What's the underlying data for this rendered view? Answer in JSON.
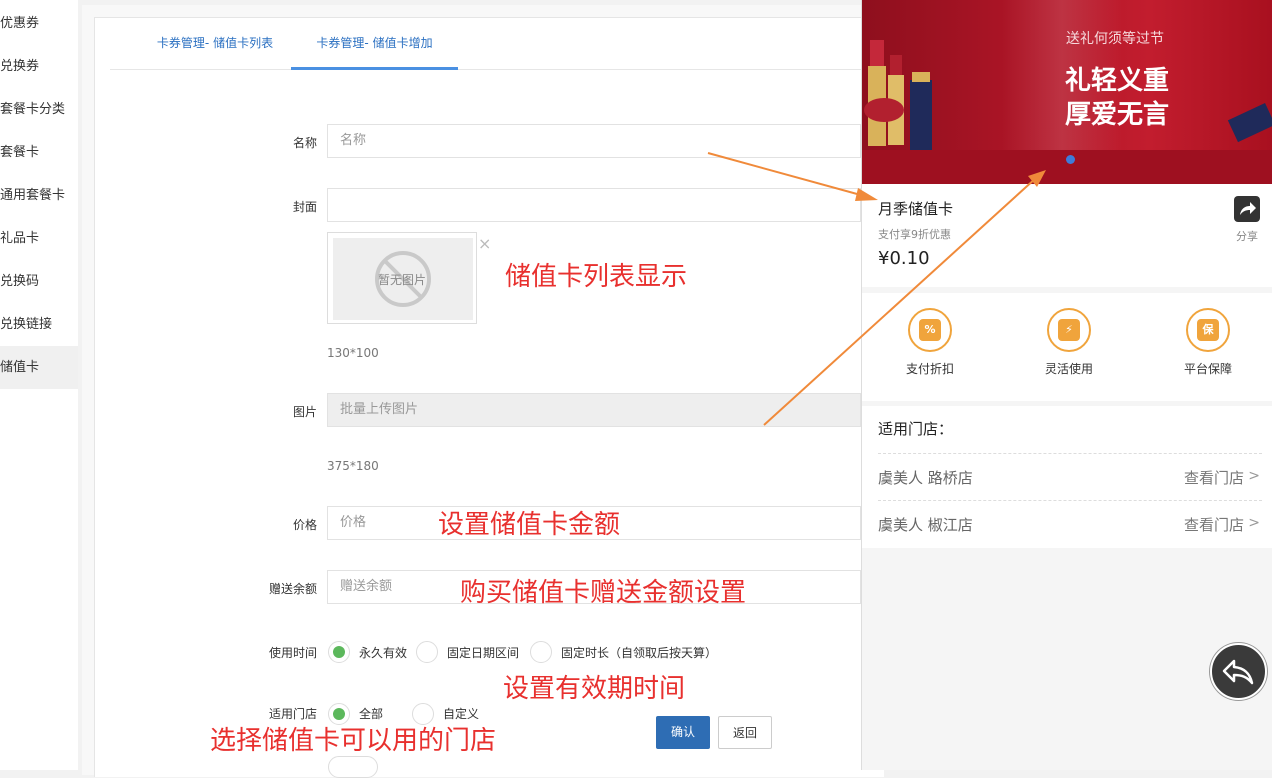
{
  "sidebar": {
    "items": [
      {
        "label": "优惠券"
      },
      {
        "label": "兑换券"
      },
      {
        "label": "套餐卡分类"
      },
      {
        "label": "套餐卡"
      },
      {
        "label": "通用套餐卡"
      },
      {
        "label": "礼品卡"
      },
      {
        "label": "兑换码"
      },
      {
        "label": "兑换链接"
      },
      {
        "label": "储值卡"
      }
    ]
  },
  "tabs": [
    {
      "label": "卡券管理- 储值卡列表"
    },
    {
      "label": "卡券管理- 储值卡增加"
    }
  ],
  "form": {
    "name_label": "名称",
    "name_placeholder": "名称",
    "cover_label": "封面",
    "cover_placeholder_text": "暂无图片",
    "cover_size": "130*100",
    "images_label": "图片",
    "images_placeholder": "批量上传图片",
    "images_size": "375*180",
    "price_label": "价格",
    "price_placeholder": "价格",
    "bonus_label": "赠送余额",
    "bonus_placeholder": "赠送余额",
    "usetime_label": "使用时间",
    "usetime_options": [
      "永久有效",
      "固定日期区间",
      "固定时长（自领取后按天算）"
    ],
    "stores_label": "适用门店",
    "stores_options": [
      "全部",
      "自定义"
    ],
    "confirm_label": "确认",
    "back_label": "返回",
    "close_symbol": "×"
  },
  "annotations": {
    "list_display": "储值卡列表显示",
    "set_amount": "设置储值卡金额",
    "bonus_setting": "购买储值卡赠送金额设置",
    "validity": "设置有效期时间",
    "stores": "选择储值卡可以用的门店"
  },
  "preview": {
    "banner_line1": "送礼何须等过节",
    "banner_line2": "礼轻义重",
    "banner_line3": "厚爱无言",
    "card_title": "月季储值卡",
    "card_subtitle": "支付享9折优惠",
    "card_price": "¥0.10",
    "share_label": "分享",
    "features": [
      {
        "label": "支付折扣",
        "icon": "discount-icon",
        "glyph": "%"
      },
      {
        "label": "灵活使用",
        "icon": "lightning-icon",
        "glyph": "⚡"
      },
      {
        "label": "平台保障",
        "icon": "shield-icon",
        "glyph": "保"
      }
    ],
    "stores_title": "适用门店：",
    "stores": [
      {
        "name": "虞美人 路桥店",
        "link": "查看门店"
      },
      {
        "name": "虞美人 椒江店",
        "link": "查看门店"
      }
    ]
  },
  "colors": {
    "primary": "#2e6db4",
    "annotation": "#e8302e",
    "arrow": "#f08a3a",
    "radio_on": "#5cb85c",
    "banner_red": "#b21628",
    "feature_orange": "#f0a43c"
  }
}
